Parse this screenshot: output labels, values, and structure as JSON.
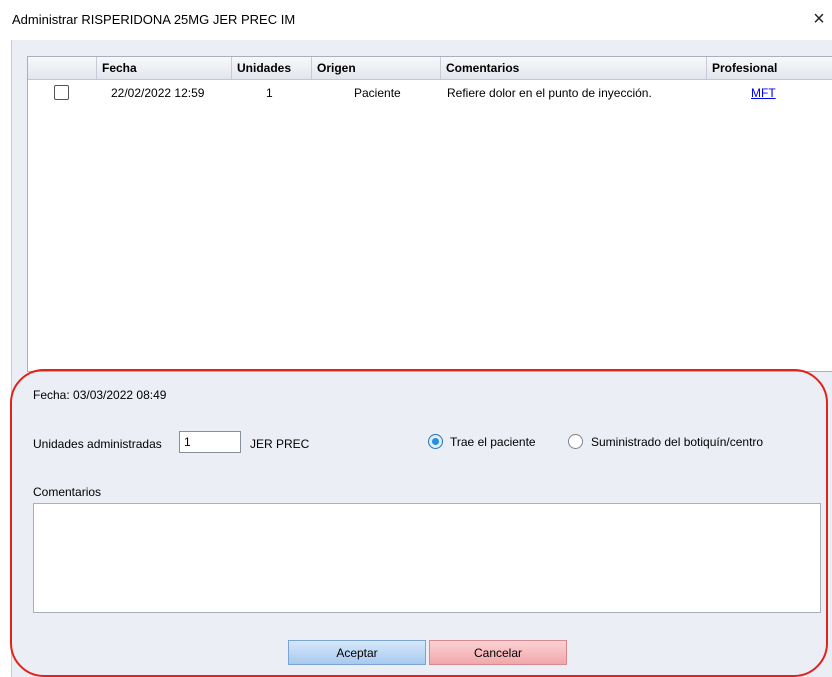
{
  "window": {
    "title": "Administrar RISPERIDONA 25MG JER PREC IM",
    "close_icon": "×"
  },
  "grid": {
    "columns": [
      "Fecha",
      "Unidades",
      "Origen",
      "Comentarios",
      "Profesional"
    ],
    "rows": [
      {
        "checked": false,
        "fecha": "22/02/2022 12:59",
        "unidades": "1",
        "origen": "Paciente",
        "comentarios": "Refiere dolor en el punto de inyección.",
        "profesional": "MFT"
      }
    ]
  },
  "form": {
    "fecha_label": "Fecha: 03/03/2022 08:49",
    "unidades_label": "Unidades administradas",
    "unidades_value": "1",
    "unit_name": "JER PREC",
    "radio_trae": "Trae el paciente",
    "radio_trae_selected": true,
    "radio_suministrado": "Suministrado del botiquín/centro",
    "comentarios_label": "Comentarios",
    "comentarios_value": ""
  },
  "buttons": {
    "accept": "Aceptar",
    "cancel": "Cancelar"
  },
  "colors": {
    "highlight_frame": "#e2231a",
    "accept": "#b6d3f3",
    "cancel": "#f4b4b8"
  }
}
